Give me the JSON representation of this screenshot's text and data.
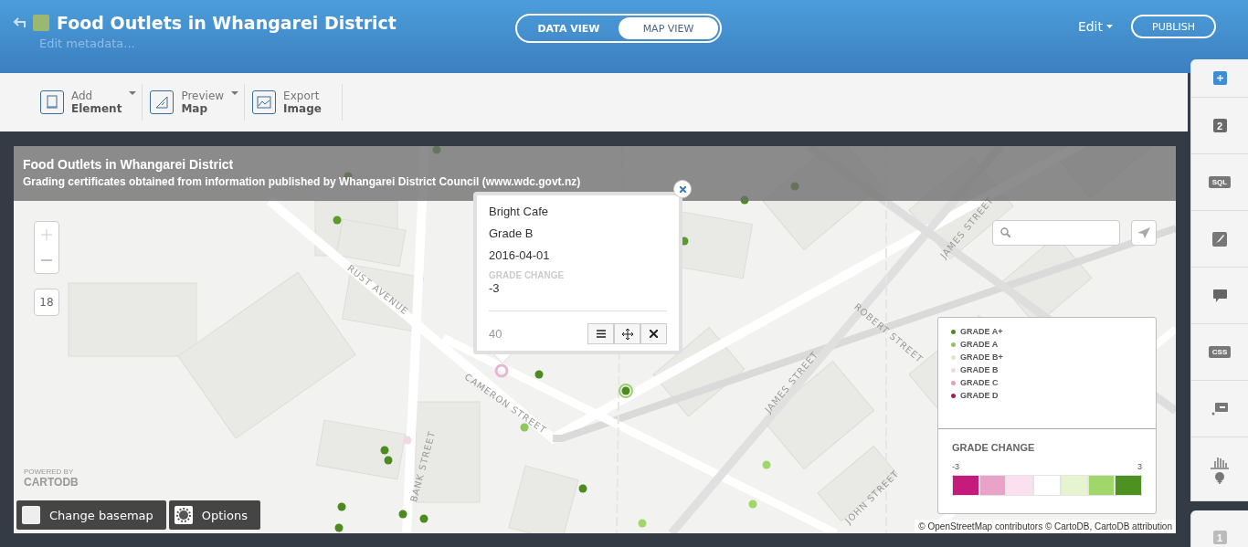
{
  "header": {
    "title": "Food Outlets in Whangarei District",
    "subtitle": "Edit metadata...",
    "view_tabs": [
      {
        "label": "DATA VIEW",
        "selected": false
      },
      {
        "label": "MAP VIEW",
        "selected": true
      }
    ],
    "edit_menu": "Edit",
    "publish": "PUBLISH"
  },
  "toolbar": [
    {
      "line1": "Add",
      "line2": "Element",
      "kind": "element",
      "dropdown": true
    },
    {
      "line1": "Preview",
      "line2": "Map",
      "kind": "preview",
      "dropdown": true
    },
    {
      "line1": "Export",
      "line2": "Image",
      "kind": "image",
      "dropdown": false
    }
  ],
  "map": {
    "title": "Food Outlets in Whangarei District",
    "description": "Grading certificates obtained from information published by Whangarei District Council (www.wdc.govt.nz)",
    "zoom_level": "18",
    "street_labels": [
      "RUST AVENUE",
      "CAMERON STREET",
      "BANK STREET",
      "JAMES STREET",
      "JAMES STREET",
      "ROBERT STREET",
      "JOHN STREET"
    ],
    "popup": {
      "lines": [
        "Bright Cafe",
        "Grade B",
        "2016-04-01"
      ],
      "field_label": "GRADE CHANGE",
      "field_value": "-3",
      "footer": "40"
    },
    "legend": {
      "items": [
        {
          "label": "GRADE A+",
          "color": "#4b8b1f"
        },
        {
          "label": "GRADE A",
          "color": "#8fc85f"
        },
        {
          "label": "GRADE B+",
          "color": "#dde9c8"
        },
        {
          "label": "GRADE B",
          "color": "#f5d6e6"
        },
        {
          "label": "GRADE C",
          "color": "#e49bc5"
        },
        {
          "label": "GRADE D",
          "color": "#b0135f"
        }
      ],
      "ramp_title": "GRADE CHANGE",
      "ramp_min": "-3",
      "ramp_max": "3",
      "ramp": [
        {
          "color": "#c51b7d"
        },
        {
          "color": "#e9a3c9"
        },
        {
          "color": "#fde0ef"
        },
        {
          "color": "#ffffff"
        },
        {
          "color": "#e6f5d0"
        },
        {
          "color": "#a1d76a"
        },
        {
          "color": "#4d9221"
        }
      ]
    },
    "branding": [
      "POWERED BY",
      "CARTODB"
    ],
    "buttons": [
      "Change basemap",
      "Options"
    ],
    "attribution": "© OpenStreetMap contributors © CartoDB, CartoDB attribution"
  },
  "sidebar": [
    {
      "kind": "add"
    },
    {
      "kind": "layer",
      "text": "2"
    },
    {
      "kind": "sql",
      "text": "SQL"
    },
    {
      "kind": "wizard"
    },
    {
      "kind": "infowindow"
    },
    {
      "kind": "css",
      "text": "CSS"
    },
    {
      "kind": "legend"
    },
    {
      "kind": "filters"
    },
    {
      "kind": "layer",
      "text": "1"
    }
  ]
}
